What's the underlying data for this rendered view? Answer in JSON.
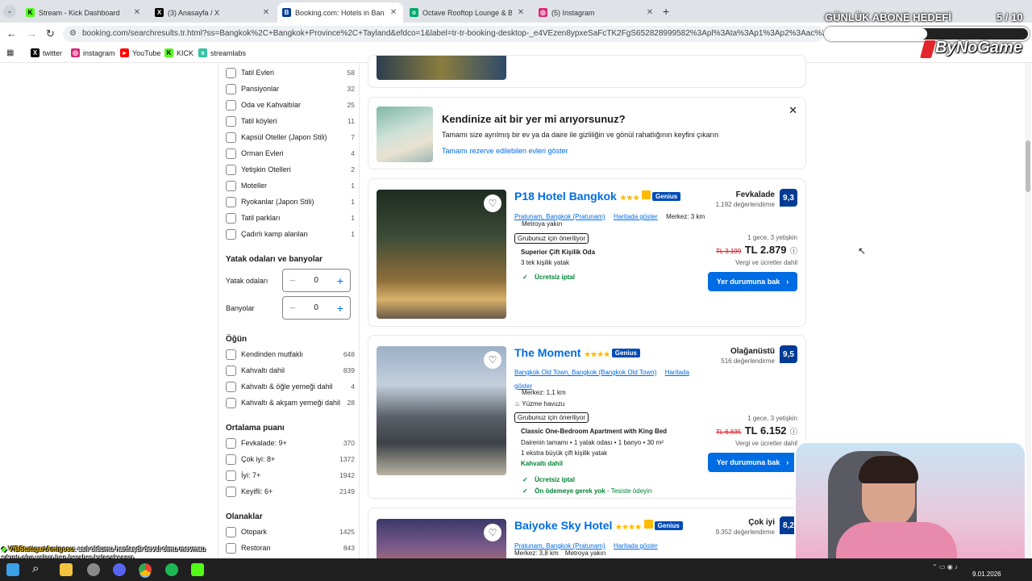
{
  "browser": {
    "tabs": [
      {
        "title": "Stream - Kick Dashboard",
        "favicon": "kick-icon",
        "color": "#53fc18"
      },
      {
        "title": "(3) Anasayfa / X",
        "favicon": "x-icon",
        "color": "#000000"
      },
      {
        "title": "Booking.com: Hotels in Bangkok",
        "favicon": "booking-icon",
        "color": "#003b95"
      },
      {
        "title": "Octave Rooftop Lounge & Bar",
        "favicon": "tripadvisor-icon",
        "color": "#00aa6c"
      },
      {
        "title": "(5) Instagram",
        "favicon": "instagram-icon",
        "color": "#d62976"
      }
    ],
    "url": "booking.com/searchresults.tr.html?ss=Bangkok%2C+Bangkok+Province%2C+Tayland&efdco=1&label=tr-tr-booking-desktop-_e4VEzen8ypxeSaFcTK2FgS652828999582%3Apl%3Ata%3Ap1%3Ap2%3Aac%3Aap%3Aneg%3A",
    "bookmarks": [
      "twitter",
      "instagram",
      "YouTube",
      "KICK",
      "streamlabs"
    ]
  },
  "overlay": {
    "goal_title": "GÜNLÜK ABONE HEDEFİ",
    "goal_count": "5 / 10",
    "goal_progress": 0.5,
    "brand": "ByNoGame",
    "chat_user": "VfBStuttgartAmigosu",
    "chat_message": ": asıl oldumu hanfaşdi devsl olmu mevmau",
    "chat_message2": "sıkıntı olur yalnız hep beraber kalacaksanız"
  },
  "filters": {
    "property_types": [
      {
        "label": "Tatil Evleri",
        "count": "58"
      },
      {
        "label": "Pansiyonlar",
        "count": "32"
      },
      {
        "label": "Oda ve Kahvaltılar",
        "count": "25"
      },
      {
        "label": "Tatil köyleri",
        "count": "11"
      },
      {
        "label": "Kapsül Oteller (Japon Stili)",
        "count": "7"
      },
      {
        "label": "Orman Evleri",
        "count": "4"
      },
      {
        "label": "Yetişkin Otelleri",
        "count": "2"
      },
      {
        "label": "Moteller",
        "count": "1"
      },
      {
        "label": "Ryokanlar (Japon Stili)",
        "count": "1"
      },
      {
        "label": "Tatil parkları",
        "count": "1"
      },
      {
        "label": "Çadırlı kamp alanları",
        "count": "1"
      }
    ],
    "rooms_title": "Yatak odaları ve banyolar",
    "bedrooms_label": "Yatak odaları",
    "bedrooms_value": "0",
    "bathrooms_label": "Banyolar",
    "bathrooms_value": "0",
    "meals_title": "Öğün",
    "meals": [
      {
        "label": "Kendinden mutfaklı",
        "count": "648"
      },
      {
        "label": "Kahvaltı dahil",
        "count": "839"
      },
      {
        "label": "Kahvaltı & öğle yemeği dahil",
        "count": "4"
      },
      {
        "label": "Kahvaltı & akşam yemeği dahil",
        "count": "28"
      }
    ],
    "rating_title": "Ortalama puanı",
    "ratings": [
      {
        "label": "Fevkalade: 9+",
        "count": "370"
      },
      {
        "label": "Çok iyi: 8+",
        "count": "1372"
      },
      {
        "label": "İyi: 7+",
        "count": "1942"
      },
      {
        "label": "Keyifli: 6+",
        "count": "2149"
      }
    ],
    "facilities_title": "Olanaklar",
    "facilities": [
      {
        "label": "Otopark",
        "count": "1425"
      },
      {
        "label": "Restoran",
        "count": "843"
      }
    ]
  },
  "promo": {
    "title": "Kendinize ait bir yer mi arıyorsunuz?",
    "text": "Tamamı size ayrılmış bir ev ya da daire ile gizliliğin ve gönül rahatlığının keyfini çıkarın",
    "link": "Tamamı rezerve edilebilen evleri göster"
  },
  "hotels": [
    {
      "name": "P18 Hotel Bangkok",
      "stars": "★★★",
      "genius": "Genius",
      "location": "Pratunam, Bangkok (Pratunam)",
      "map": "Haritada göster",
      "distance": "Merkez: 3 km",
      "extra": "Metroya yakın",
      "recommend": "Grubunuz için öneriliyor",
      "room": "Superior Çift Kişilik Oda",
      "room_detail": "3 tek kişilik yatak",
      "perk1": "Ücretsiz iptal",
      "rating_word": "Fevkalade",
      "reviews": "1.192 değerlendirme",
      "score": "9,3",
      "nights": "1 gece, 3 yetişkin",
      "old_price": "TL 3.199",
      "price": "TL 2.879",
      "tax": "Vergi ve ücretler dahil",
      "cta": "Yer durumuna bak"
    },
    {
      "name": "The Moment",
      "stars": "★★★★",
      "genius": "Genius",
      "location": "Bangkok Old Town, Bangkok (Bangkok Old Town)",
      "map": "Haritada göster",
      "distance": "Merkez: 1,1 km",
      "extra": "Yüzme havuzu",
      "recommend": "Grubunuz için öneriliyor",
      "room": "Classic One-Bedroom Apartment with King Bed",
      "room_detail": "Dairenin tamamı • 1 yatak odası • 1 banyo • 30 m²",
      "room_detail2": "1 ekstra büyük çift kişilik yatak",
      "meal": "Kahvaltı dahil",
      "perk1": "Ücretsiz iptal",
      "perk2": "Ön ödemeye gerek yok",
      "perk2_suffix": " - Tesiste ödeyin",
      "rating_word": "Olağanüstü",
      "reviews": "516 değerlendirme",
      "score": "9,5",
      "nights": "1 gece, 3 yetişkin",
      "old_price": "TL 6.835",
      "price": "TL 6.152",
      "tax": "Vergi ve ücretler dahil",
      "cta": "Yer durumuna bak"
    },
    {
      "name": "Baiyoke Sky Hotel",
      "stars": "★★★★",
      "genius": "Genius",
      "location": "Pratunam, Bangkok (Pratunam)",
      "map": "Haritada göster",
      "distance": "Merkez: 3,8 km",
      "extra": "Metroya yakın",
      "rating_word": "Çok iyi",
      "reviews": "9.352 değerlendirme",
      "score": "8,2"
    }
  ],
  "taskbar": {
    "date": "9.01.2026"
  }
}
